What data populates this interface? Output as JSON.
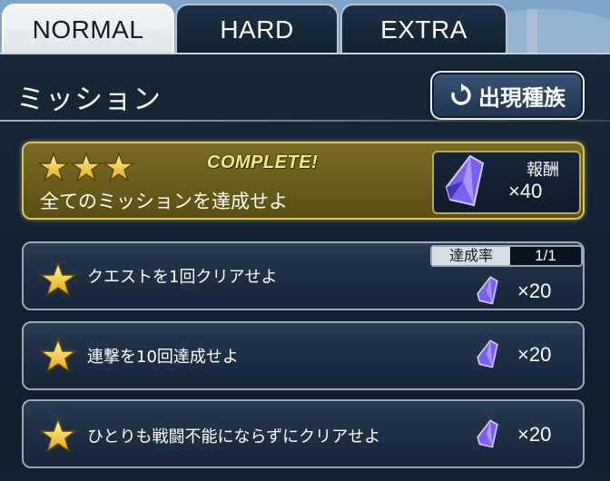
{
  "tabs": [
    {
      "label": "NORMAL",
      "active": true
    },
    {
      "label": "HARD",
      "active": false
    },
    {
      "label": "EXTRA",
      "active": false
    }
  ],
  "panel": {
    "title": "ミッション",
    "appear_button": {
      "label": "出現種族",
      "icon": "refresh-icon"
    }
  },
  "complete_mission": {
    "stars": 3,
    "status": "COMPLETE!",
    "text": "全てのミッションを達成せよ",
    "reward_label": "報酬",
    "reward_amount": "×40",
    "reward_icon": "crystal-icon"
  },
  "missions": [
    {
      "stars": 1,
      "text": "クエストを1回クリアせよ",
      "rate_label": "達成率",
      "rate_value": "1/1",
      "reward": "×20",
      "reward_icon": "crystal-icon"
    },
    {
      "stars": 1,
      "text": "連撃を10回達成せよ",
      "reward": "×20",
      "reward_icon": "crystal-icon"
    },
    {
      "stars": 1,
      "text": "ひとりも戦闘不能にならずにクリアせよ",
      "reward": "×20",
      "reward_icon": "crystal-icon"
    }
  ],
  "colors": {
    "star_gold": "#f6d22a",
    "crystal_purple": "#8b6cf0",
    "complete_gold": "#f3e78a",
    "panel_dark": "#10202f"
  }
}
